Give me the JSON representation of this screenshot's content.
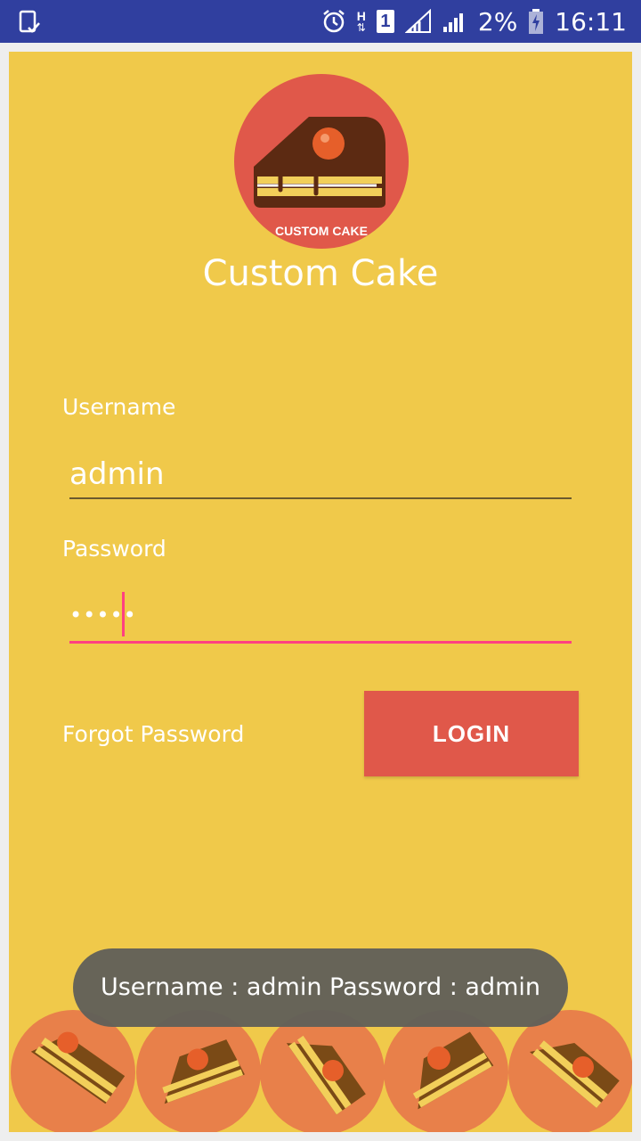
{
  "status_bar": {
    "battery_percent": "2%",
    "time": "16:11",
    "network_type": "H",
    "sim_slot": "1",
    "icons": [
      "screenshot-notification-icon",
      "alarm-icon",
      "network-h-icon",
      "sim-1-icon",
      "signal-icon",
      "signal-icon",
      "battery-charging-icon"
    ]
  },
  "app": {
    "title": "Custom Cake",
    "logo_text": "CUSTOM CAKE",
    "colors": {
      "background": "#f0c94a",
      "accent": "#e0584a",
      "focus": "#ff4081"
    }
  },
  "form": {
    "username_label": "Username",
    "username_value": "admin",
    "password_label": "Password",
    "password_value": "•••••",
    "forgot_label": "Forgot Password",
    "login_label": "LOGIN"
  },
  "toast": {
    "message": "Username : admin Password : admin"
  },
  "footer": {
    "cake_icon_count": 5
  }
}
